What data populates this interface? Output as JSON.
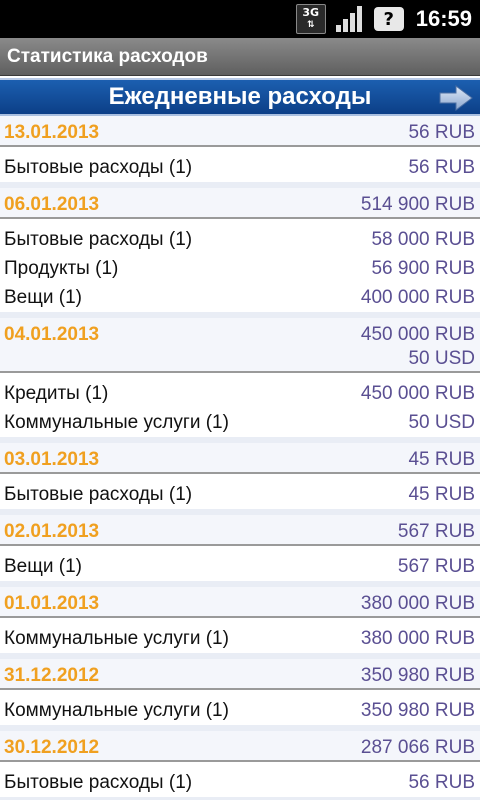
{
  "status_bar": {
    "network": "3G",
    "time": "16:59",
    "icons": [
      "3g-data-icon",
      "signal-strength-icon",
      "battery-unknown-icon"
    ]
  },
  "app": {
    "title": "Статистика расходов"
  },
  "header": {
    "title": "Ежедневные расходы",
    "next_icon": "arrow-right-icon"
  },
  "colors": {
    "date": "#f0a020",
    "amount": "#5a4f92",
    "header_band": "#1c5fb0"
  },
  "days": [
    {
      "date": "13.01.2013",
      "totals": [
        "56 RUB"
      ],
      "items": [
        {
          "name": "Бытовые расходы (1)",
          "amount": "56 RUB"
        }
      ]
    },
    {
      "date": "06.01.2013",
      "totals": [
        "514 900 RUB"
      ],
      "items": [
        {
          "name": "Бытовые расходы (1)",
          "amount": "58 000 RUB"
        },
        {
          "name": "Продукты (1)",
          "amount": "56 900 RUB"
        },
        {
          "name": "Вещи (1)",
          "amount": "400 000 RUB"
        }
      ]
    },
    {
      "date": "04.01.2013",
      "totals": [
        "450 000 RUB",
        "50 USD"
      ],
      "items": [
        {
          "name": "Кредиты (1)",
          "amount": "450 000 RUB"
        },
        {
          "name": "Коммунальные услуги (1)",
          "amount": "50 USD"
        }
      ]
    },
    {
      "date": "03.01.2013",
      "totals": [
        "45 RUB"
      ],
      "items": [
        {
          "name": "Бытовые расходы (1)",
          "amount": "45 RUB"
        }
      ]
    },
    {
      "date": "02.01.2013",
      "totals": [
        "567 RUB"
      ],
      "items": [
        {
          "name": "Вещи (1)",
          "amount": "567 RUB"
        }
      ]
    },
    {
      "date": "01.01.2013",
      "totals": [
        "380 000 RUB"
      ],
      "items": [
        {
          "name": "Коммунальные услуги (1)",
          "amount": "380 000 RUB"
        }
      ]
    },
    {
      "date": "31.12.2012",
      "totals": [
        "350 980 RUB"
      ],
      "items": [
        {
          "name": "Коммунальные услуги (1)",
          "amount": "350 980 RUB"
        }
      ]
    },
    {
      "date": "30.12.2012",
      "totals": [
        "287 066 RUB"
      ],
      "items": [
        {
          "name": "Бытовые расходы (1)",
          "amount": "56 RUB"
        }
      ]
    }
  ]
}
